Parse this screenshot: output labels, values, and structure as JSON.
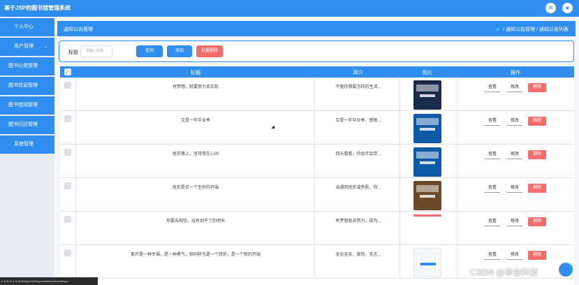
{
  "header": {
    "app_title": "基于JSP的图书馆管理系统",
    "close_icon": "✕",
    "user_icon": "●"
  },
  "sidebar": {
    "items": [
      {
        "label": "个人中心"
      },
      {
        "label": "用户管理"
      },
      {
        "label": "图书分类管理"
      },
      {
        "label": "图书信息管理"
      },
      {
        "label": "图书借阅管理"
      },
      {
        "label": "图书归还管理"
      },
      {
        "label": "系统管理"
      }
    ]
  },
  "content": {
    "page_title": "通知公告管理",
    "breadcrumb": "/ 通知公告管理 / 通知公告列表"
  },
  "search": {
    "label": "标题",
    "placeholder": "请输入标题",
    "query_label": "查询",
    "add_label": "添加",
    "batch_delete_label": "批量删除"
  },
  "table": {
    "headers": {
      "title": "标题",
      "summary": "简介",
      "image": "图片",
      "actions": "操作"
    },
    "rows": [
      {
        "title": "有梦想，就要努力去实现",
        "summary": "不管你想要怎样的生活...",
        "thumb_color": "#1a2a4a"
      },
      {
        "title": "又是一年毕业季",
        "summary": "又是一年毕业季，感慨...",
        "thumb_color": "#0f5aa8"
      },
      {
        "title": "挫折路上，坚持常在心间",
        "summary": "回头看看，你会不会觉...",
        "thumb_color": "#0f5aa8"
      },
      {
        "title": "挫折是另一个生命的开端",
        "summary": "当遇到挫折或失败，你...",
        "thumb_color": "#6b4a2a"
      },
      {
        "title": "你要去相信，没有到不了的明天",
        "summary": "有梦想就去努力，因为...",
        "thumb_color": "#f56c6c"
      },
      {
        "title": "离开是一种幸福，是一种勇气，但同样也是一个转折，是一个新的开端",
        "summary": "无论无奈，离别、无言...",
        "thumb_color": "#f5f7fa"
      }
    ],
    "action_labels": {
      "view": "查看",
      "edit": "修改",
      "delete": "删除"
    }
  },
  "status": {
    "url_text": "8.129.11.174:8080/jspm0xfh/jsp/modules/news/list.jsp"
  },
  "overlay": {
    "watermark": "CSDN @李会科技"
  },
  "colors": {
    "primary": "#2f8ef0",
    "danger": "#f56c6c"
  }
}
